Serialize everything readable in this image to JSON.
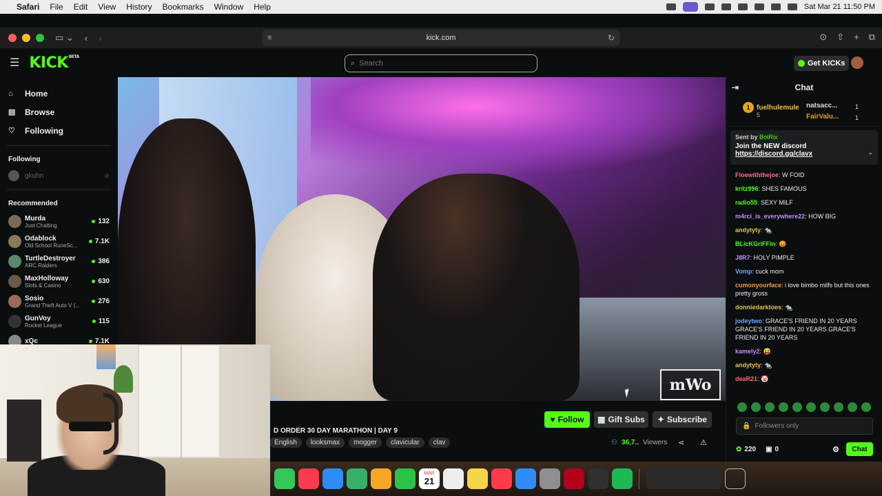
{
  "menubar": {
    "app": "Safari",
    "items": [
      "File",
      "Edit",
      "View",
      "History",
      "Bookmarks",
      "Window",
      "Help"
    ],
    "datetime": "Sat Mar 21  11:50 PM"
  },
  "browser": {
    "url": "kick.com"
  },
  "header": {
    "logo": "KICK",
    "logo_badge": "BETA",
    "search_placeholder": "Search",
    "get_kicks": "Get KICKs"
  },
  "sidebar": {
    "nav": [
      {
        "label": "Home",
        "icon": "home-icon"
      },
      {
        "label": "Browse",
        "icon": "browse-icon"
      },
      {
        "label": "Following",
        "icon": "heart-icon"
      }
    ],
    "following_header": "Following",
    "following": [
      {
        "name": "gkuhn"
      }
    ],
    "recommended_header": "Recommended",
    "recommended": [
      {
        "name": "Murda",
        "category": "Just Chatting",
        "viewers": "132"
      },
      {
        "name": "Odablock",
        "category": "Old School RuneSc...",
        "viewers": "7.1K"
      },
      {
        "name": "TurtleDestroyer",
        "category": "ARC Raiders",
        "viewers": "386"
      },
      {
        "name": "MaxHolloway",
        "category": "Slots & Casino",
        "viewers": "630"
      },
      {
        "name": "Sosio",
        "category": "Grand Theft Auto V (...",
        "viewers": "276"
      },
      {
        "name": "GunVoy",
        "category": "Rocket League",
        "viewers": "115"
      },
      {
        "name": "xQc",
        "category": "",
        "viewers": "7.1K"
      }
    ]
  },
  "stream": {
    "title": "D ORDER 30 DAY MARATHON | DAY 9",
    "watermark": "mWo",
    "follow_label": "Follow",
    "gift_label": "Gift Subs",
    "subscribe_label": "Subscribe",
    "tags": [
      "English",
      "looksmax",
      "mogger",
      "clavicular",
      "clav"
    ],
    "viewers": "36,7..",
    "viewers_label": "Viewers"
  },
  "chat": {
    "title": "Chat",
    "leaderboard": [
      {
        "rank": "1",
        "name": "fuelhulemule",
        "count": "5"
      },
      {
        "name": "natsacc...",
        "count": "1"
      },
      {
        "name": "FairValu...",
        "count": "1"
      }
    ],
    "pinned": {
      "sent_by": "Sent by",
      "bot": "BotRix",
      "message": "Join the NEW discord",
      "link": "https://discord.gg/clavx"
    },
    "messages": [
      {
        "user": "Floewiththejoe",
        "text": "W FOID",
        "color": "#ff6b8a"
      },
      {
        "user": "kritz996",
        "text": "SHES FAMOUS",
        "color": "#53fc18"
      },
      {
        "user": "radio55",
        "text": "SEXY MILF",
        "color": "#53fc18"
      },
      {
        "user": "m4rci_is_everywhere22",
        "text": "HOW BIG",
        "color": "#c68cff"
      },
      {
        "user": "andytyty",
        "text": "🐀",
        "color": "#e6c24a"
      },
      {
        "user": "BLicKGriFFin",
        "text": "😡",
        "color": "#53fc18"
      },
      {
        "user": "J8R7",
        "text": "HOLY PIMPLE",
        "color": "#c68cff"
      },
      {
        "user": "Vomp",
        "text": "cuck mom",
        "color": "#6aa9ff"
      },
      {
        "user": "cumonyourface",
        "text": "i love bimbo milfs but this ones pretty gross",
        "color": "#ff9a3c"
      },
      {
        "user": "donniedarktoes",
        "text": "🐀",
        "color": "#e6c24a"
      },
      {
        "user": "jodeytwo",
        "text": "GRACE'S FRIEND IN 20 YEARS GRACE'S FRIEND IN 20 YEARS GRACE'S FRIEND IN 20 YEARS",
        "color": "#6aa9ff"
      },
      {
        "user": "kamely2",
        "text": "😝",
        "color": "#c68cff"
      },
      {
        "user": "andytyty",
        "text": "🐀",
        "color": "#e6c24a"
      },
      {
        "user": "deaR21",
        "text": "🤡",
        "color": "#ff6b6b"
      }
    ],
    "input_placeholder": "Followers only",
    "points": "220",
    "gifts": "0",
    "send_label": "Chat"
  },
  "dock": {
    "icons": [
      "messages-icon",
      "music-icon",
      "mail-icon",
      "maps-icon",
      "photos-icon",
      "facetime-icon",
      "calendar-icon",
      "reminders-icon",
      "notes-icon",
      "news-icon",
      "app-store-icon",
      "settings-icon",
      "acrobat-icon",
      "obs-icon",
      "spotify-icon",
      "finder-window-icon",
      "trash-icon"
    ],
    "calendar_day": "21",
    "calendar_month": "MAR"
  },
  "colors": {
    "accent": "#53fc18",
    "background": "#0b0e0f"
  }
}
